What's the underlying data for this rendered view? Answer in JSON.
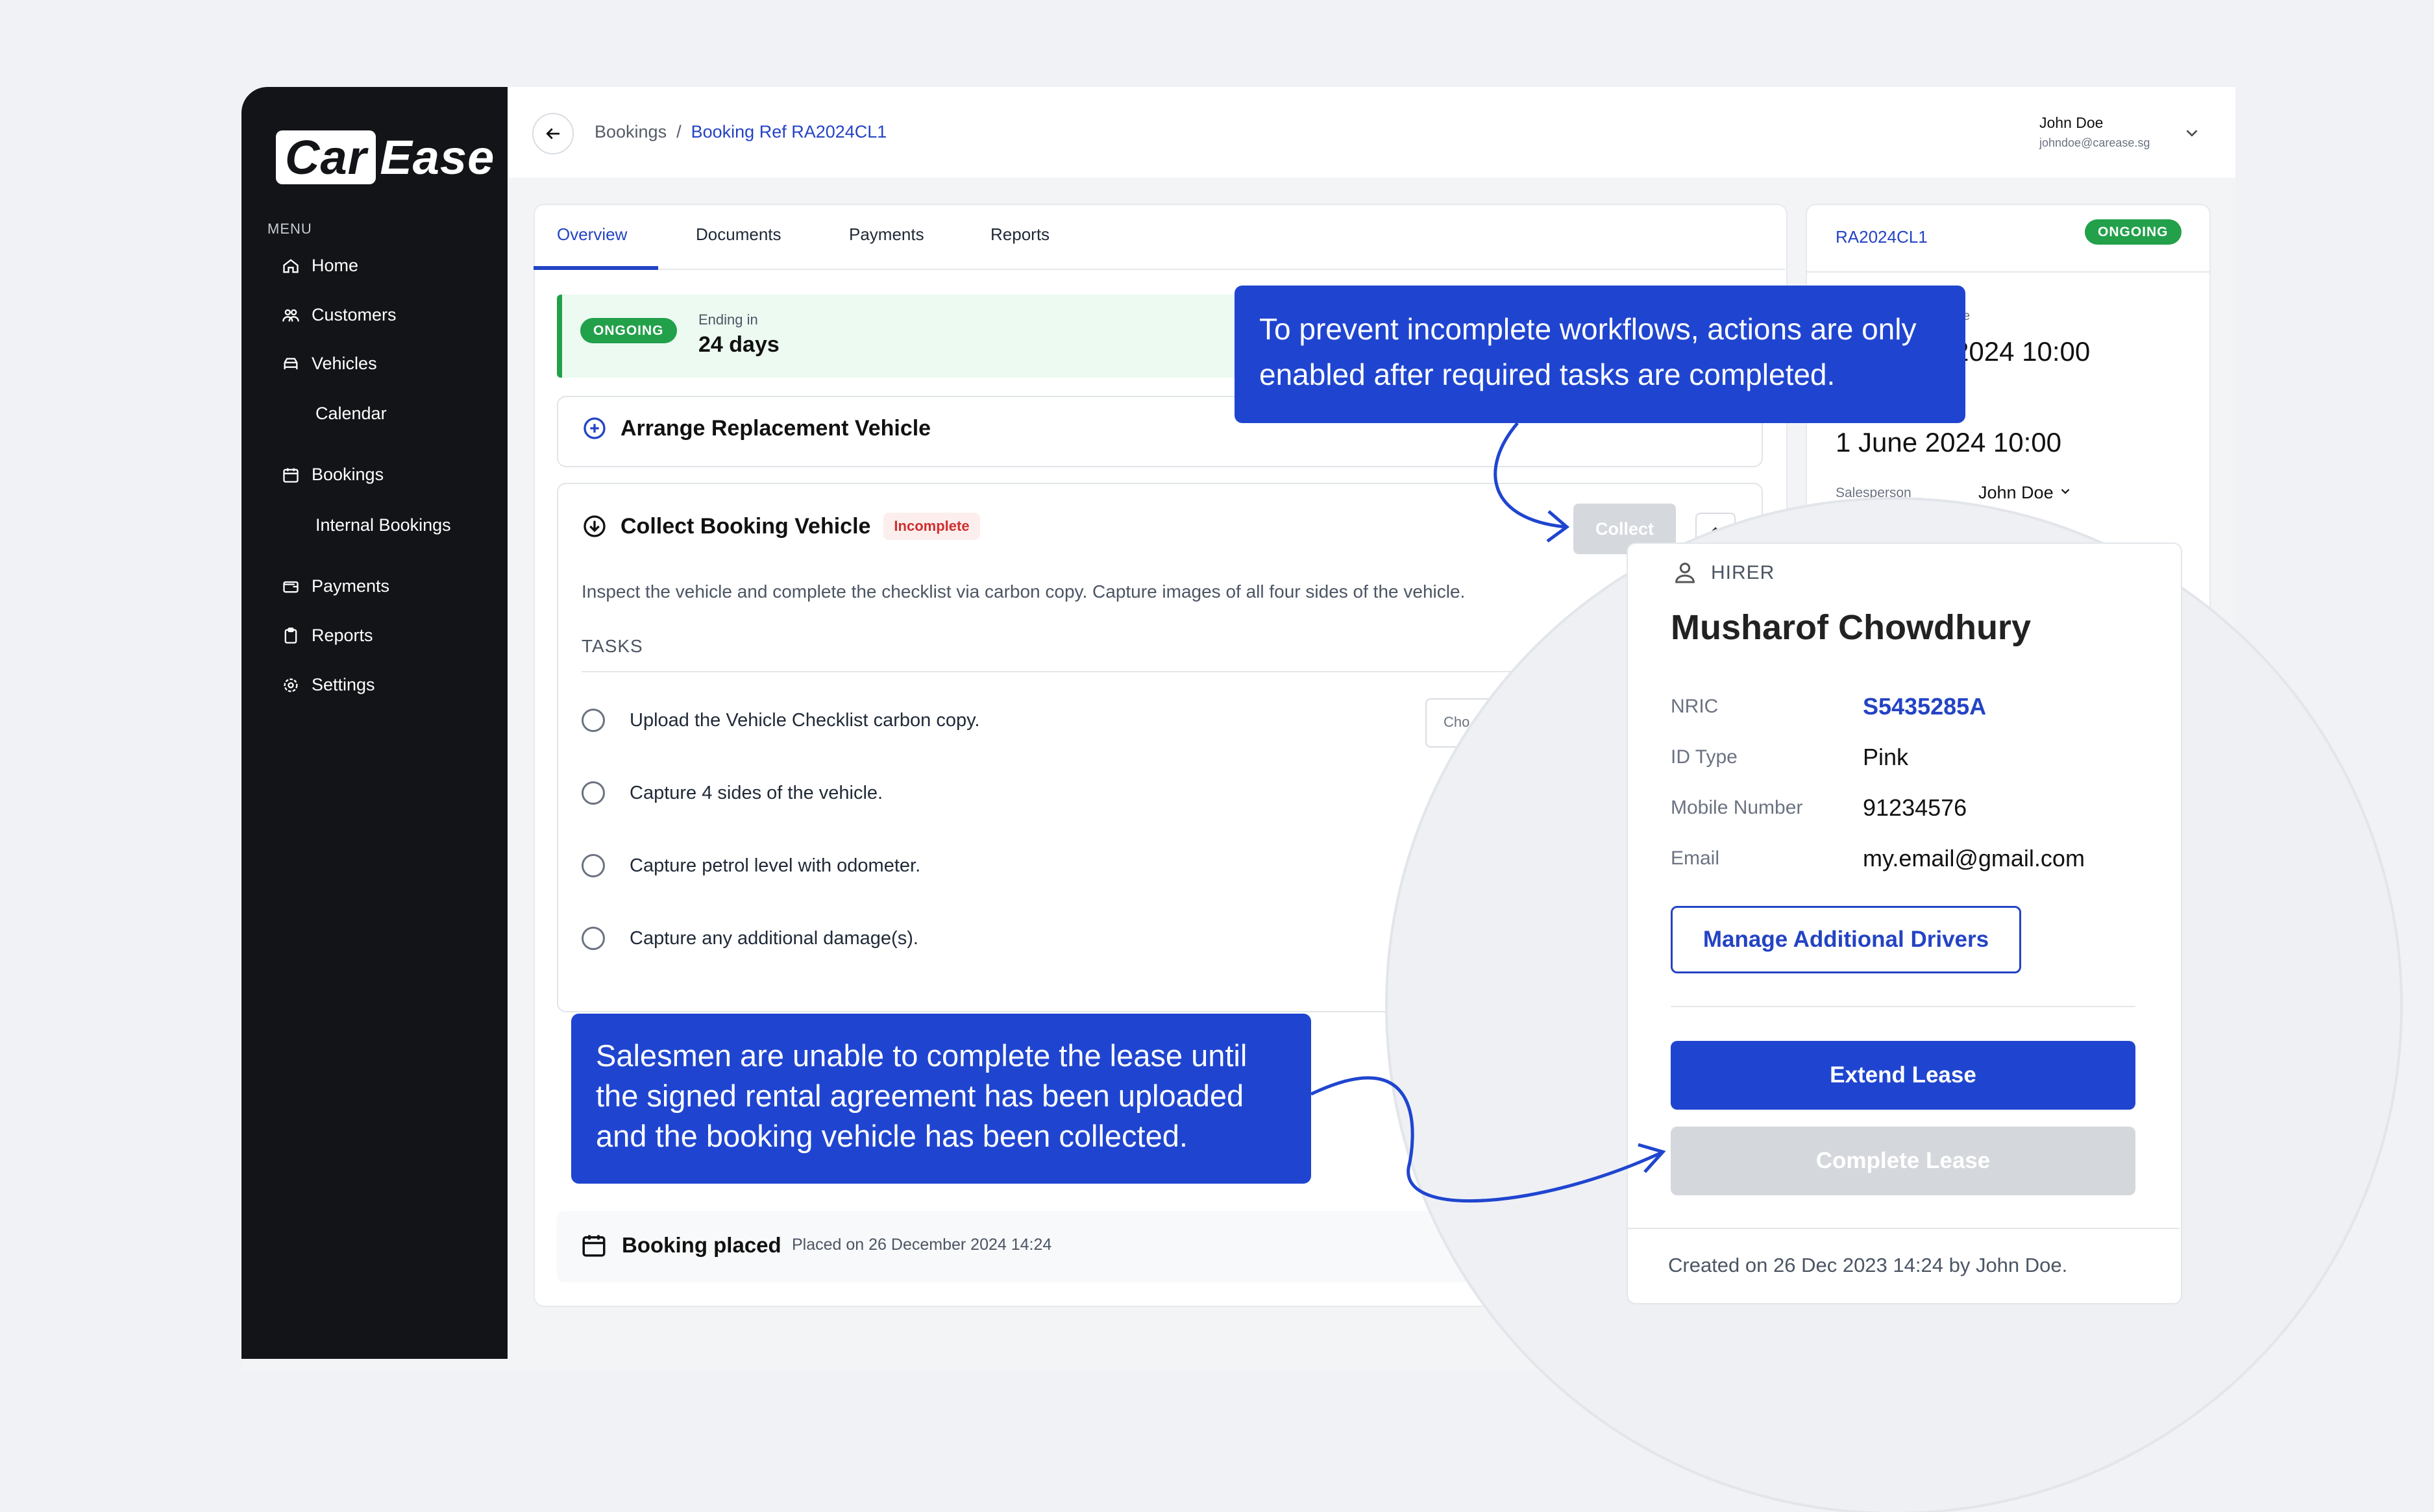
{
  "app": {
    "brand_part1": "Car",
    "brand_part2": "Ease"
  },
  "sidebar": {
    "menu_heading": "MENU",
    "items": [
      {
        "label": "Home",
        "icon": "home-icon"
      },
      {
        "label": "Customers",
        "icon": "users-icon"
      },
      {
        "label": "Vehicles",
        "icon": "car-icon"
      },
      {
        "label": "Calendar"
      },
      {
        "label": "Bookings",
        "icon": "calendar-icon"
      },
      {
        "label": "Internal Bookings"
      },
      {
        "label": "Payments",
        "icon": "wallet-icon"
      },
      {
        "label": "Reports",
        "icon": "clipboard-icon"
      },
      {
        "label": "Settings",
        "icon": "gear-icon"
      }
    ]
  },
  "header": {
    "breadcrumb": {
      "root": "Bookings",
      "separator": "/",
      "current": "Booking Ref RA2024CL1"
    },
    "user": {
      "name": "John Doe",
      "email": "johndoe@carease.sg"
    }
  },
  "tabs": [
    "Overview",
    "Documents",
    "Payments",
    "Reports"
  ],
  "status": {
    "badge": "ONGOING",
    "ending_label": "Ending in",
    "ending_value": "24 days"
  },
  "replacement": {
    "title": "Arrange Replacement Vehicle"
  },
  "collect": {
    "title": "Collect Booking Vehicle",
    "badge": "Incomplete",
    "button": "Collect",
    "description": "Inspect the vehicle and complete the checklist via carbon copy. Capture images of all four sides of the vehicle.",
    "tasks_heading": "TASKS",
    "tasks": [
      "Upload the Vehicle Checklist carbon copy.",
      "Capture 4 sides of the vehicle.",
      "Capture petrol level with odometer.",
      "Capture any additional damage(s)."
    ],
    "choose_partial": "Cho"
  },
  "booking_placed": {
    "title": "Booking placed",
    "subtitle": "Placed on 26 December 2024 14:24"
  },
  "right_panel": {
    "ref": "RA2024CL1",
    "badge": "ONGOING",
    "start_label_partial": "e",
    "start_partial": "2024 10:00",
    "end": "1 June 2024 10:00",
    "salesperson_label": "Salesperson",
    "salesperson": "John Doe"
  },
  "hirer": {
    "label": "HIRER",
    "name": "Musharof Chowdhury",
    "fields": [
      {
        "key": "NRIC",
        "value": "S5435285A"
      },
      {
        "key": "ID Type",
        "value": "Pink"
      },
      {
        "key": "Mobile Number",
        "value": "91234576"
      },
      {
        "key": "Email",
        "value": "my.email@gmail.com"
      }
    ],
    "manage_button": "Manage Additional Drivers",
    "extend_button": "Extend Lease",
    "complete_button": "Complete Lease",
    "created": "Created on 26 Dec 2023 14:24 by John Doe."
  },
  "callouts": {
    "top": "To prevent incomplete workflows, actions are only enabled after required tasks are completed.",
    "bottom": "Salesmen are unable to complete the lease until the signed rental agreement has been uploaded and the booking vehicle has been collected."
  },
  "colors": {
    "accent": "#1f45d0",
    "success": "#22a04a",
    "danger": "#d12f2f",
    "sidebar": "#121417"
  }
}
